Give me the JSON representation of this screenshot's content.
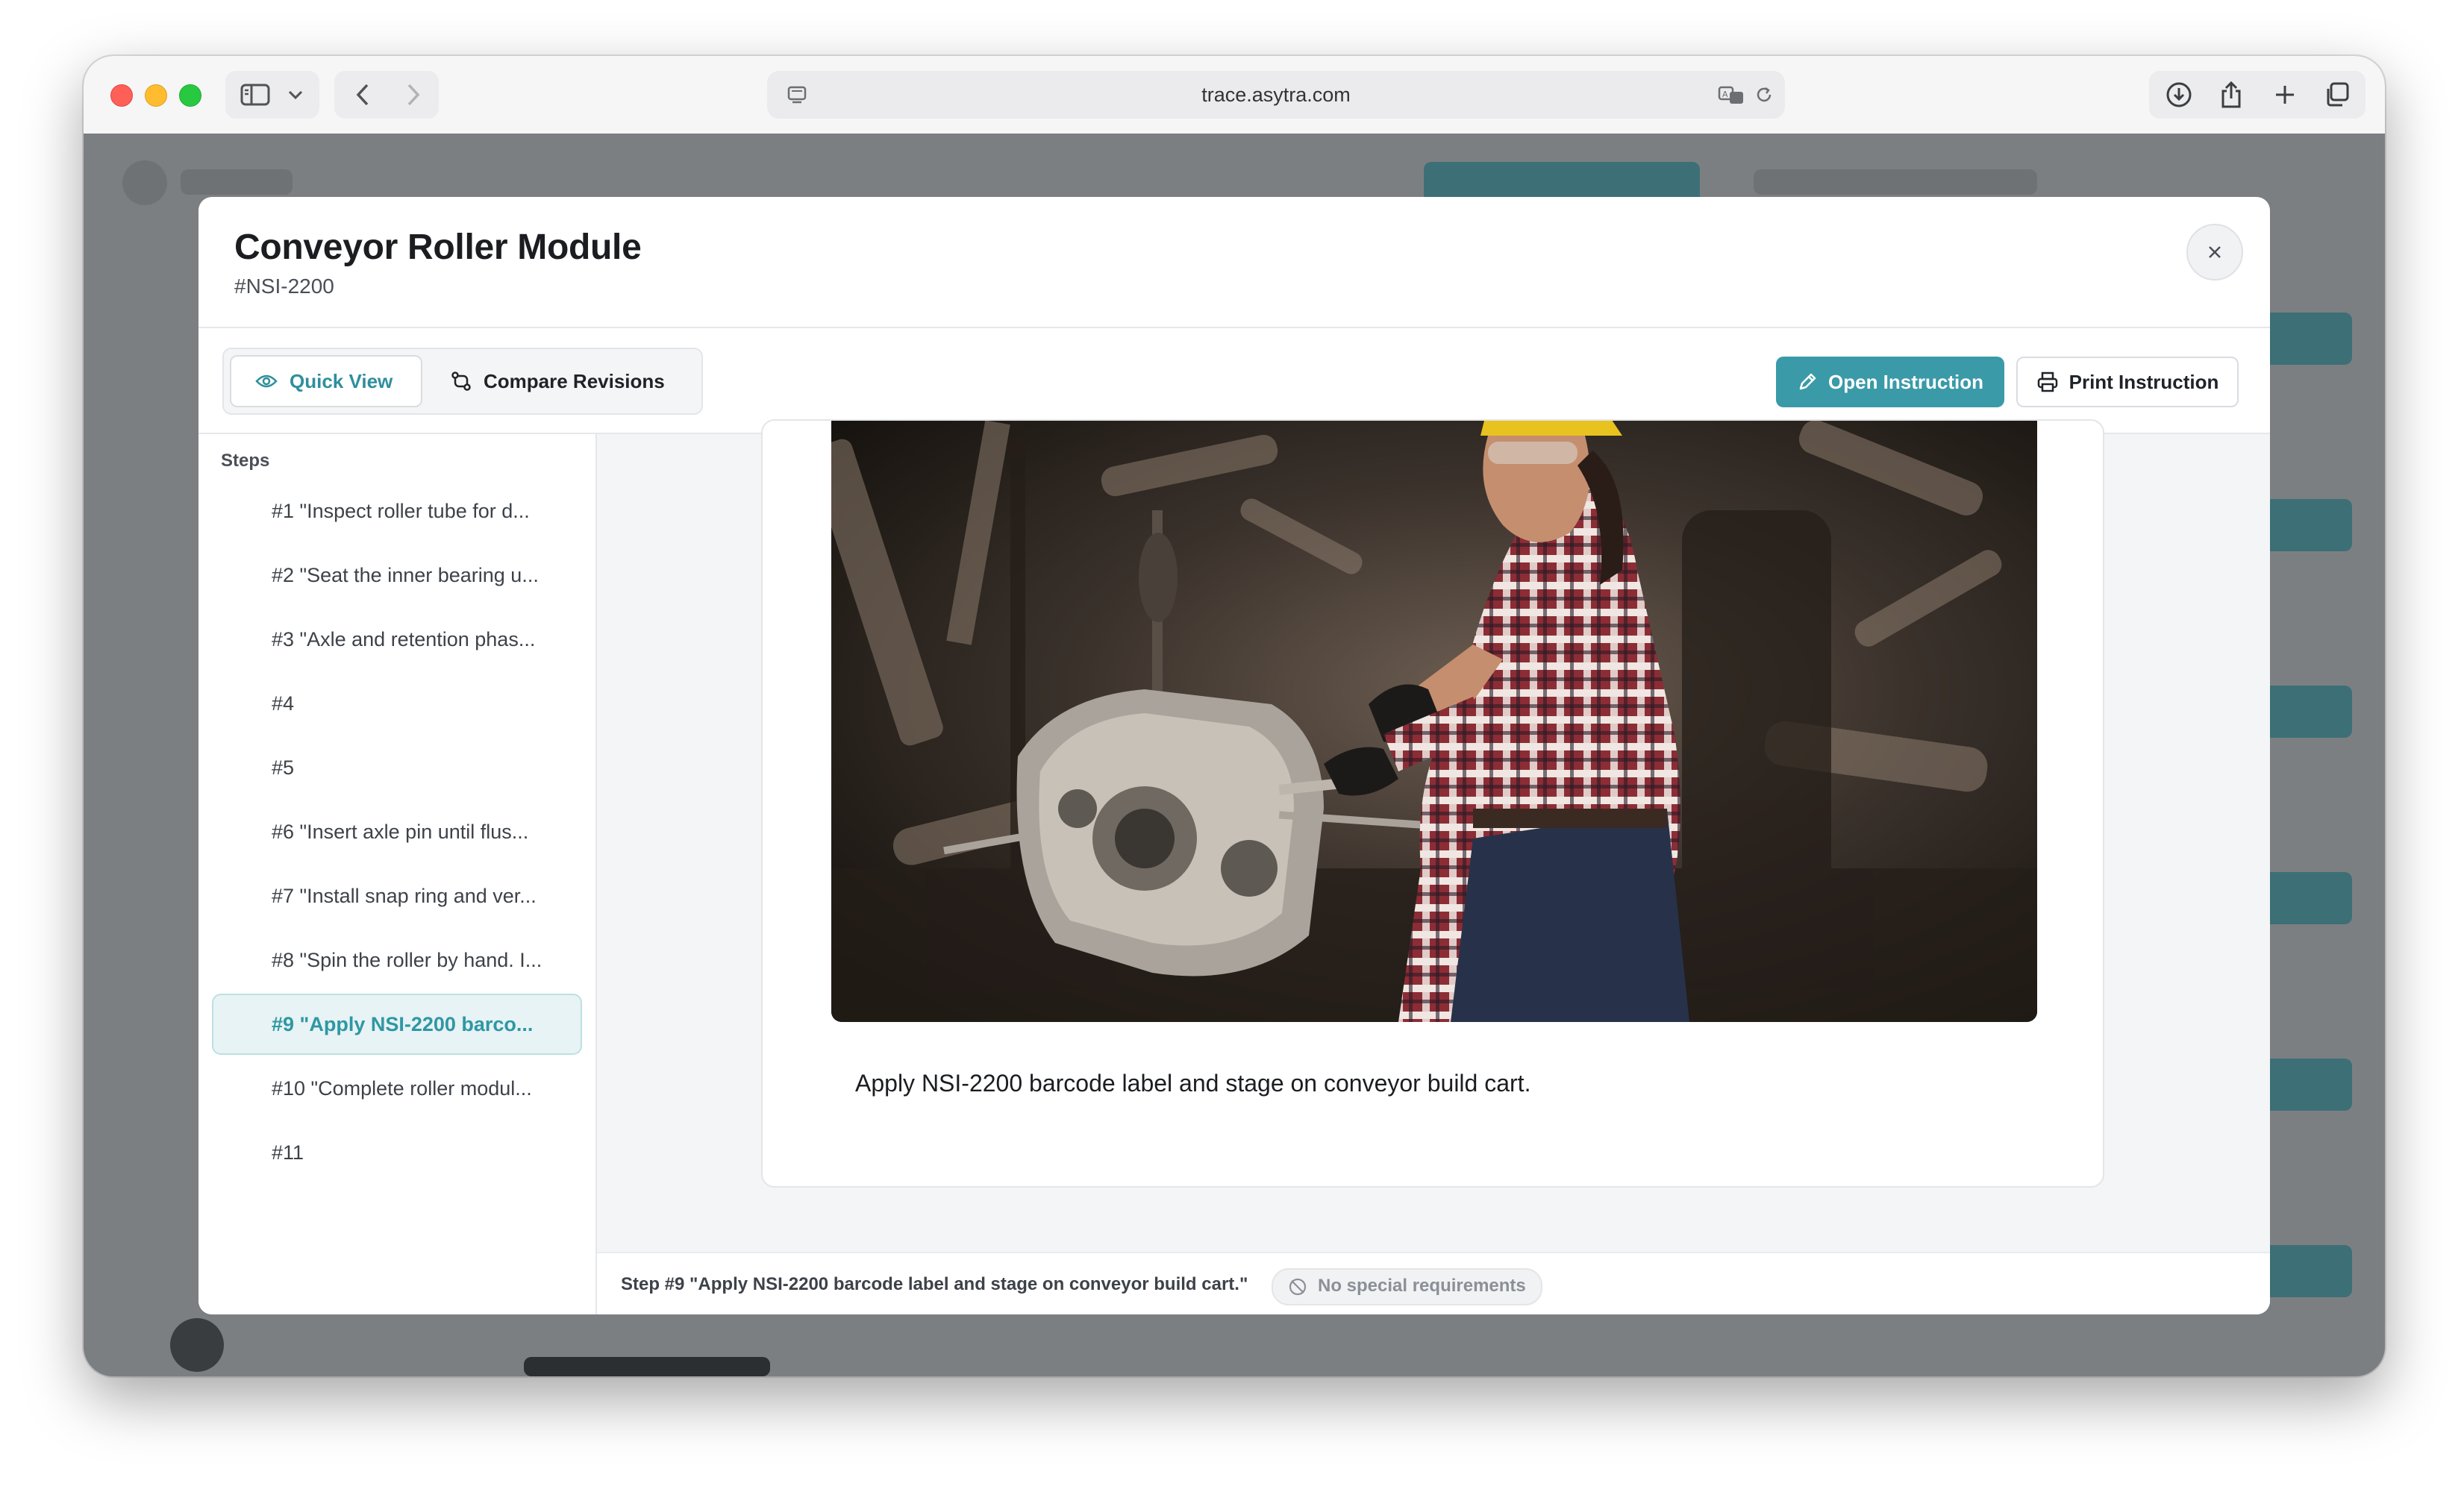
{
  "browser": {
    "url": "trace.asytra.com"
  },
  "modal": {
    "title": "Conveyor Roller Module",
    "subtitle": "#NSI-2200",
    "tabs": [
      {
        "label": "Quick View",
        "active": true
      },
      {
        "label": "Compare Revisions",
        "active": false
      }
    ],
    "actions": {
      "open_label": "Open Instruction",
      "print_label": "Print Instruction"
    },
    "accent_color": "#3a9aa8"
  },
  "sidebar": {
    "heading": "Steps",
    "steps": [
      {
        "label": "#1 \"Inspect roller tube for d..."
      },
      {
        "label": "#2 \"Seat the inner bearing u..."
      },
      {
        "label": "#3 \"Axle and retention phas..."
      },
      {
        "label": "#4"
      },
      {
        "label": "#5"
      },
      {
        "label": "#6 \"Insert axle pin until flus..."
      },
      {
        "label": "#7 \"Install snap ring and ver..."
      },
      {
        "label": "#8 \"Spin the roller by hand. I..."
      },
      {
        "label": "#9 \"Apply NSI-2200 barco...",
        "active": true
      },
      {
        "label": "#10 \"Complete roller modul..."
      },
      {
        "label": "#11"
      }
    ]
  },
  "main": {
    "caption": "Apply NSI-2200 barcode label and stage on conveyor build cart."
  },
  "footer": {
    "step_text": "Step #9 \"Apply NSI-2200 barcode label and stage on conveyor build cart.\"",
    "chip_label": "No special requirements"
  }
}
